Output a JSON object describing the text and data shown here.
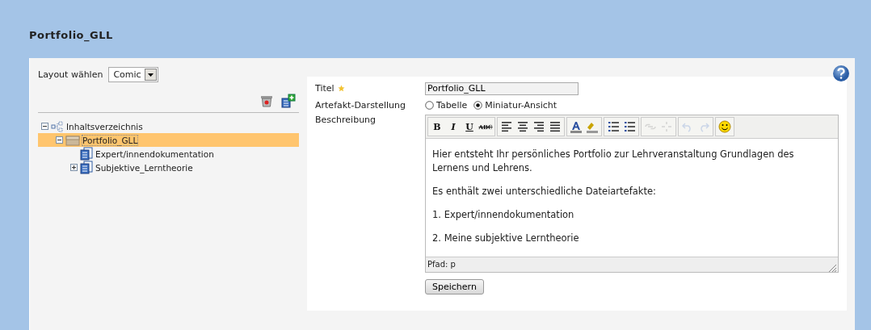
{
  "page": {
    "title": "Portfolio_GLL"
  },
  "layout": {
    "label": "Layout wählen",
    "value": "Comic"
  },
  "tree": [
    {
      "label": "Inhaltsverzeichnis",
      "kind": "root",
      "expanded": true,
      "selected": false,
      "children": [
        {
          "label": "Portfolio_GLL",
          "kind": "folder",
          "expanded": true,
          "selected": true,
          "children": [
            {
              "label": "Expert/innendokumentation",
              "kind": "page",
              "selected": false
            },
            {
              "label": "Subjektive_Lerntheorie",
              "kind": "page",
              "expanded": false,
              "selected": false
            }
          ]
        }
      ]
    }
  ],
  "form": {
    "title_label": "Titel",
    "title_value": "Portfolio_GLL",
    "display_label": "Artefakt-Darstellung",
    "display_options": [
      {
        "label": "Tabelle",
        "selected": false
      },
      {
        "label": "Miniatur-Ansicht",
        "selected": true
      }
    ],
    "description_label": "Beschreibung"
  },
  "toolbar": [
    [
      {
        "kind": "bold",
        "text": "B",
        "disabled": false
      },
      {
        "kind": "italic",
        "text": "I",
        "disabled": false
      },
      {
        "kind": "underline",
        "text": "U",
        "disabled": false
      },
      {
        "kind": "strike",
        "text": "ABC",
        "disabled": false
      }
    ],
    [
      {
        "kind": "align-left",
        "disabled": false
      },
      {
        "kind": "align-center",
        "disabled": false
      },
      {
        "kind": "align-right",
        "disabled": false
      },
      {
        "kind": "justify",
        "disabled": false
      }
    ],
    [
      {
        "kind": "text-color",
        "disabled": false
      },
      {
        "kind": "highlight",
        "disabled": false
      }
    ],
    [
      {
        "kind": "bullets",
        "disabled": false
      },
      {
        "kind": "numbers",
        "disabled": false
      }
    ],
    [
      {
        "kind": "link",
        "disabled": true
      },
      {
        "kind": "unlink",
        "disabled": true
      }
    ],
    [
      {
        "kind": "undo",
        "disabled": true
      },
      {
        "kind": "redo",
        "disabled": true
      }
    ],
    [
      {
        "kind": "smiley",
        "disabled": false
      }
    ]
  ],
  "editor": {
    "paragraphs": [
      "Hier entsteht Ihr persönliches Portfolio zur Lehrveranstaltung Grundlagen des Lernens und Lehrens.",
      "Es enthält zwei unterschiedliche Dateiartefakte:",
      "1. Expert/innendokumentation",
      "2. Meine subjektive Lerntheorie"
    ],
    "path": "Pfad: p"
  },
  "save_button": "Speichern"
}
